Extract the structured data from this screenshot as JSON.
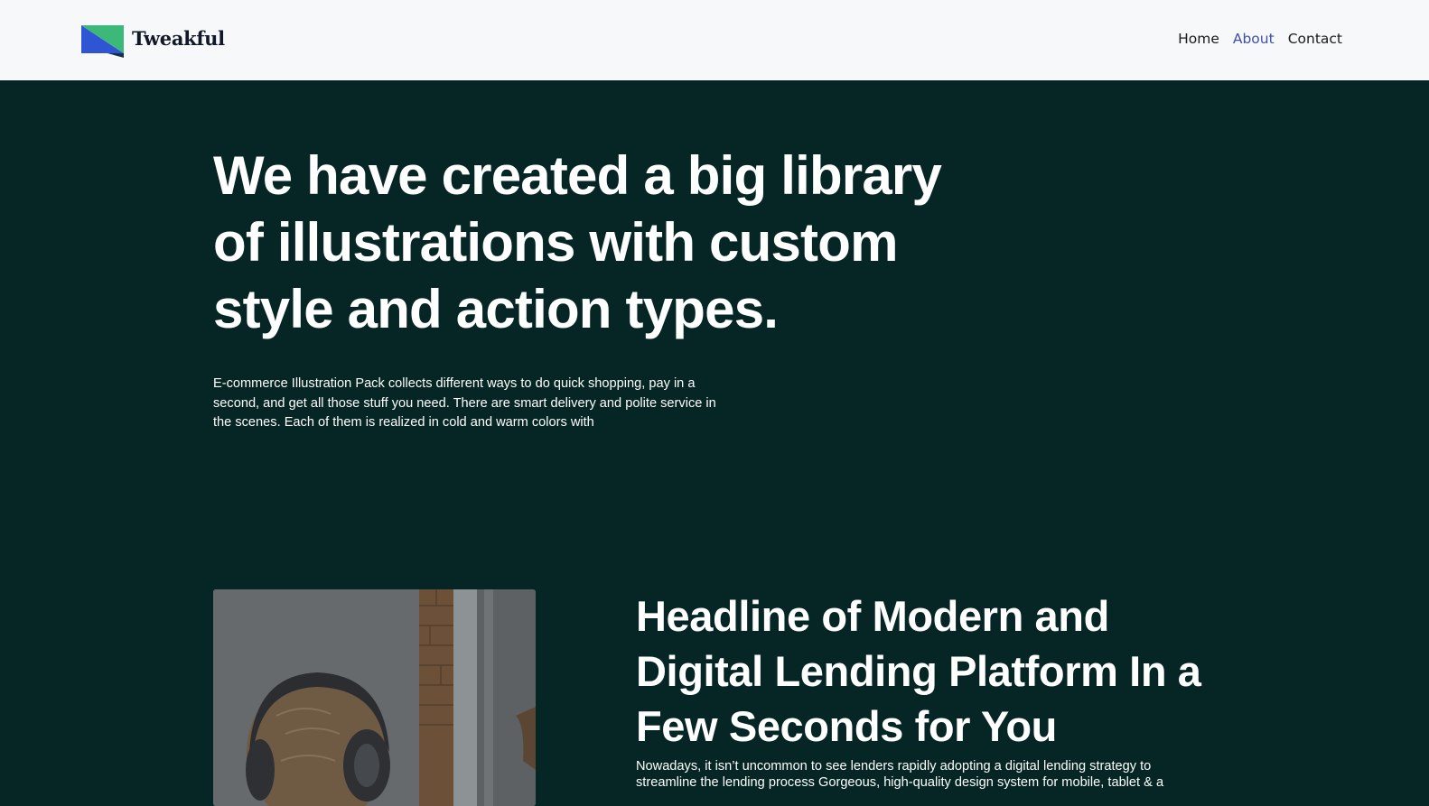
{
  "brand": {
    "name": "Tweakful",
    "logo_colors": {
      "blue": "#2f55d4",
      "green": "#3cb878",
      "dark": "#12324a"
    }
  },
  "nav": {
    "items": [
      {
        "label": "Home",
        "active": false
      },
      {
        "label": "About",
        "active": true
      },
      {
        "label": "Contact",
        "active": false
      }
    ]
  },
  "hero": {
    "title": "We have created a big library of illustrations with custom style and action types.",
    "body": "E-commerce Illustration Pack collects different ways to do quick shopping, pay in a second, and get all those stuff you need. There are smart delivery and polite service in the scenes. Each of them is realized in cold and warm colors with"
  },
  "feature": {
    "image_alt": "person wearing headphones",
    "title": "Headline of Modern and Digital Lending Platform In a Few Seconds for You",
    "body": "Nowadays, it isn’t uncommon to see lenders rapidly adopting a digital lending strategy to streamline the lending process Gorgeous, high-quality design system for mobile, tablet & a"
  },
  "colors": {
    "page_bg": "#052624",
    "nav_bg": "#f7f8fa",
    "active_link": "#3d4fa8",
    "text_light": "#ffffff"
  }
}
